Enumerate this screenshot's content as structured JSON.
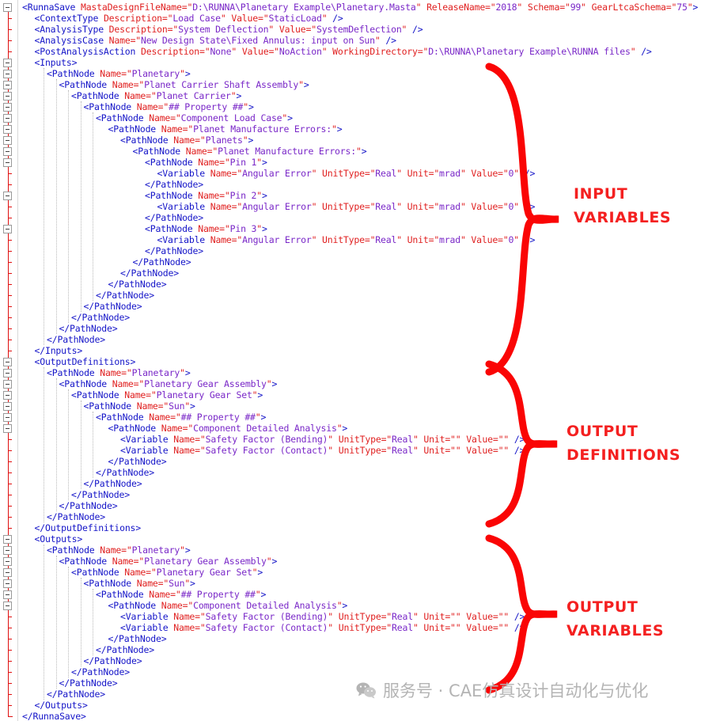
{
  "document": {
    "type": "xml-source-listing",
    "root_element": "RunnaSave"
  },
  "code_lines": [
    {
      "indent": 0,
      "text": "<RunnaSave MastaDesignFileName=\"D:\\RUNNA\\Planetary Example\\Planetary.Masta\" ReleaseName=\"2018\" Schema=\"99\" GearLtcaSchema=\"75\">"
    },
    {
      "indent": 1,
      "text": "<ContextType Description=\"Load Case\" Value=\"StaticLoad\" />"
    },
    {
      "indent": 1,
      "text": "<AnalysisType Description=\"System Deflection\" Value=\"SystemDeflection\" />"
    },
    {
      "indent": 1,
      "text": "<AnalysisCase Name=\"New Design State\\Fixed Annulus: input on Sun\" />"
    },
    {
      "indent": 1,
      "text": "<PostAnalysisAction Description=\"None\" Value=\"NoAction\" WorkingDirectory=\"D:\\RUNNA\\Planetary Example\\RUNNA files\" />"
    },
    {
      "indent": 1,
      "text": "<Inputs>"
    },
    {
      "indent": 2,
      "text": "<PathNode Name=\"Planetary\">"
    },
    {
      "indent": 3,
      "text": "<PathNode Name=\"Planet Carrier Shaft Assembly\">"
    },
    {
      "indent": 4,
      "text": "<PathNode Name=\"Planet Carrier\">"
    },
    {
      "indent": 5,
      "text": "<PathNode Name=\"## Property ##\">"
    },
    {
      "indent": 6,
      "text": "<PathNode Name=\"Component Load Case\">"
    },
    {
      "indent": 7,
      "text": "<PathNode Name=\"Planet Manufacture Errors:\">"
    },
    {
      "indent": 8,
      "text": "<PathNode Name=\"Planets\">"
    },
    {
      "indent": 9,
      "text": "<PathNode Name=\"Planet Manufacture Errors:\">"
    },
    {
      "indent": 10,
      "text": "<PathNode Name=\"Pin 1\">"
    },
    {
      "indent": 11,
      "text": "<Variable Name=\"Angular Error\" UnitType=\"Real\" Unit=\"mrad\" Value=\"0\" />"
    },
    {
      "indent": 10,
      "text": "</PathNode>"
    },
    {
      "indent": 10,
      "text": "<PathNode Name=\"Pin 2\">"
    },
    {
      "indent": 11,
      "text": "<Variable Name=\"Angular Error\" UnitType=\"Real\" Unit=\"mrad\" Value=\"0\" />"
    },
    {
      "indent": 10,
      "text": "</PathNode>"
    },
    {
      "indent": 10,
      "text": "<PathNode Name=\"Pin 3\">"
    },
    {
      "indent": 11,
      "text": "<Variable Name=\"Angular Error\" UnitType=\"Real\" Unit=\"mrad\" Value=\"0\" />"
    },
    {
      "indent": 10,
      "text": "</PathNode>"
    },
    {
      "indent": 9,
      "text": "</PathNode>"
    },
    {
      "indent": 8,
      "text": "</PathNode>"
    },
    {
      "indent": 7,
      "text": "</PathNode>"
    },
    {
      "indent": 6,
      "text": "</PathNode>"
    },
    {
      "indent": 5,
      "text": "</PathNode>"
    },
    {
      "indent": 4,
      "text": "</PathNode>"
    },
    {
      "indent": 3,
      "text": "</PathNode>"
    },
    {
      "indent": 2,
      "text": "</PathNode>"
    },
    {
      "indent": 1,
      "text": "</Inputs>"
    },
    {
      "indent": 1,
      "text": "<OutputDefinitions>"
    },
    {
      "indent": 2,
      "text": "<PathNode Name=\"Planetary\">"
    },
    {
      "indent": 3,
      "text": "<PathNode Name=\"Planetary Gear Assembly\">"
    },
    {
      "indent": 4,
      "text": "<PathNode Name=\"Planetary Gear Set\">"
    },
    {
      "indent": 5,
      "text": "<PathNode Name=\"Sun\">"
    },
    {
      "indent": 6,
      "text": "<PathNode Name=\"## Property ##\">"
    },
    {
      "indent": 7,
      "text": "<PathNode Name=\"Component Detailed Analysis\">"
    },
    {
      "indent": 8,
      "text": "<Variable Name=\"Safety Factor (Bending)\" UnitType=\"Real\" Unit=\"\" Value=\"\" />"
    },
    {
      "indent": 8,
      "text": "<Variable Name=\"Safety Factor (Contact)\" UnitType=\"Real\" Unit=\"\" Value=\"\" />"
    },
    {
      "indent": 7,
      "text": "</PathNode>"
    },
    {
      "indent": 6,
      "text": "</PathNode>"
    },
    {
      "indent": 5,
      "text": "</PathNode>"
    },
    {
      "indent": 4,
      "text": "</PathNode>"
    },
    {
      "indent": 3,
      "text": "</PathNode>"
    },
    {
      "indent": 2,
      "text": "</PathNode>"
    },
    {
      "indent": 1,
      "text": "</OutputDefinitions>"
    },
    {
      "indent": 1,
      "text": "<Outputs>"
    },
    {
      "indent": 2,
      "text": "<PathNode Name=\"Planetary\">"
    },
    {
      "indent": 3,
      "text": "<PathNode Name=\"Planetary Gear Assembly\">"
    },
    {
      "indent": 4,
      "text": "<PathNode Name=\"Planetary Gear Set\">"
    },
    {
      "indent": 5,
      "text": "<PathNode Name=\"Sun\">"
    },
    {
      "indent": 6,
      "text": "<PathNode Name=\"## Property ##\">"
    },
    {
      "indent": 7,
      "text": "<PathNode Name=\"Component Detailed Analysis\">"
    },
    {
      "indent": 8,
      "text": "<Variable Name=\"Safety Factor (Bending)\" UnitType=\"Real\" Unit=\"\" Value=\"\" />"
    },
    {
      "indent": 8,
      "text": "<Variable Name=\"Safety Factor (Contact)\" UnitType=\"Real\" Unit=\"\" Value=\"\" />"
    },
    {
      "indent": 7,
      "text": "</PathNode>"
    },
    {
      "indent": 6,
      "text": "</PathNode>"
    },
    {
      "indent": 5,
      "text": "</PathNode>"
    },
    {
      "indent": 4,
      "text": "</PathNode>"
    },
    {
      "indent": 3,
      "text": "</PathNode>"
    },
    {
      "indent": 2,
      "text": "</PathNode>"
    },
    {
      "indent": 1,
      "text": "</Outputs>"
    },
    {
      "indent": 0,
      "text": "</RunnaSave>"
    }
  ],
  "annotations": [
    {
      "id": "input-variables",
      "line1": "INPUT",
      "line2": "VARIABLES",
      "color": "#f42020"
    },
    {
      "id": "output-definitions",
      "line1": "OUTPUT",
      "line2": "DEFINITIONS",
      "color": "#f42020"
    },
    {
      "id": "output-variables",
      "line1": "OUTPUT",
      "line2": "VARIABLES",
      "color": "#f42020"
    }
  ],
  "watermark": {
    "icon": "wechat-icon",
    "text": "服务号 · CAE仿真设计自动化与优化",
    "color": "#b4b4b4"
  },
  "colors": {
    "tag": "#1414c8",
    "attribute": "#e02020",
    "value": "#7a28c8",
    "annotation": "#f42020",
    "fold_rail": "#e01010",
    "background": "#ffffff"
  }
}
